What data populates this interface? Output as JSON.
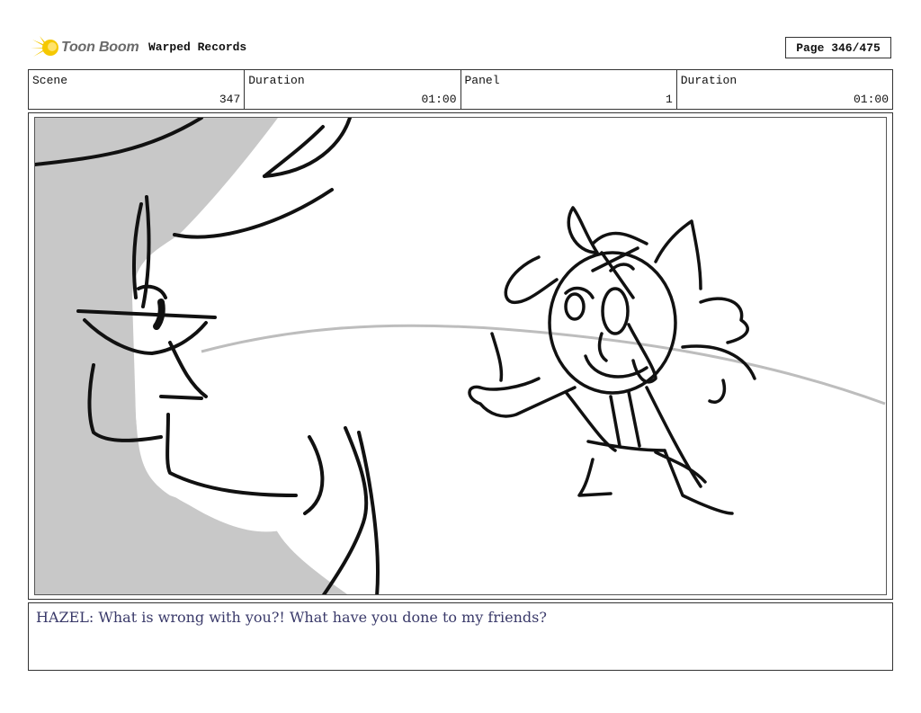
{
  "header": {
    "logo_text": "Toon Boom",
    "project_title": "Warped Records",
    "page_label": "Page 346/475"
  },
  "info": [
    {
      "label": "Scene",
      "value": "347"
    },
    {
      "label": "Duration",
      "value": "01:00"
    },
    {
      "label": "Panel",
      "value": "1"
    },
    {
      "label": "Duration",
      "value": "01:00"
    }
  ],
  "panel": {
    "description": ""
  },
  "dialogue": {
    "text": "HAZEL: What is wrong with you?! What have you done to my friends?"
  },
  "colors": {
    "logo_yellow": "#f5c800",
    "shadow_gray": "#c8c8c8",
    "dialogue_text": "#3a3a6a"
  }
}
